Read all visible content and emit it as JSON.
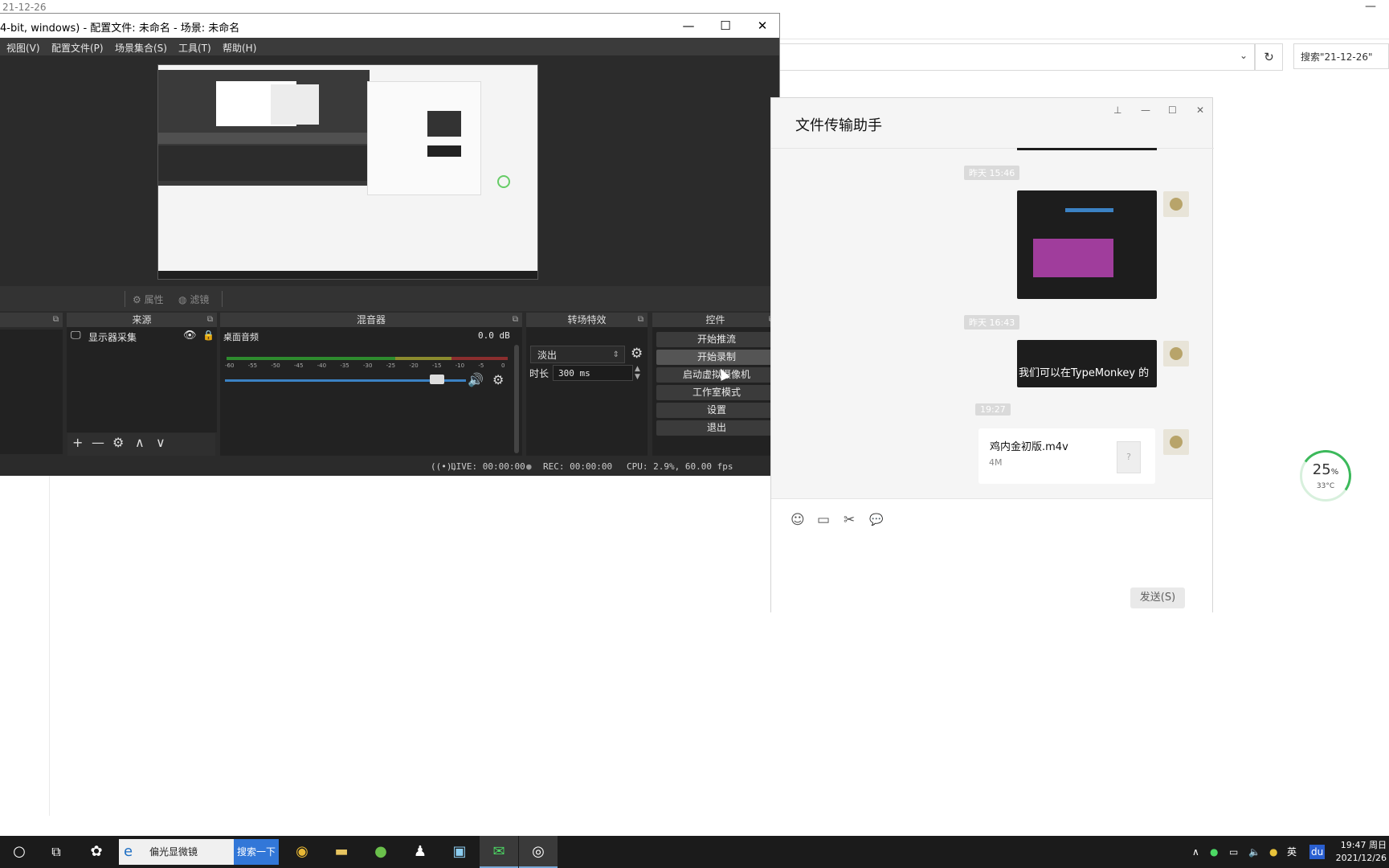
{
  "explorer": {
    "title_fragment": "21-12-26",
    "minimize": "—",
    "refresh_icon": "↻",
    "search_placeholder": "搜索\"21-12-26\""
  },
  "obs": {
    "title": "4-bit, windows) - 配置文件: 未命名 - 场景: 未命名",
    "window_buttons": {
      "minimize": "—",
      "maximize": "☐",
      "close": "✕"
    },
    "menu": [
      "视图(V)",
      "配置文件(P)",
      "场景集合(S)",
      "工具(T)",
      "帮助(H)"
    ],
    "toolbar": {
      "properties": "属性",
      "filters": "滤镜"
    },
    "docks": {
      "sources": "来源",
      "mixer": "混音器",
      "transitions": "转场特效",
      "controls": "控件"
    },
    "sources": {
      "items": [
        {
          "label": "显示器采集"
        }
      ]
    },
    "source_buttons": {
      "add": "+",
      "remove": "—",
      "settings": "⚙",
      "up": "∧",
      "down": "∨"
    },
    "mixer": {
      "track": "桌面音频",
      "db": "0.0 dB",
      "ticks": [
        "-60",
        "-55",
        "-50",
        "-45",
        "-40",
        "-35",
        "-30",
        "-25",
        "-20",
        "-15",
        "-10",
        "-5",
        "0"
      ],
      "volume": 0.88
    },
    "transitions": {
      "selected": "淡出",
      "duration_label": "时长",
      "duration": "300 ms"
    },
    "controls": [
      "开始推流",
      "开始录制",
      "启动虚拟摄像机",
      "工作室模式",
      "设置",
      "退出"
    ],
    "status": {
      "live": "LIVE: 00:00:00",
      "rec": "REC: 00:00:00",
      "cpu": "CPU: 2.9%, 60.00 fps"
    }
  },
  "wechat": {
    "title": "文件传输助手",
    "window_buttons": {
      "pin": "⊥",
      "minimize": "—",
      "maximize": "☐",
      "close": "✕"
    },
    "messages": {
      "time1": "昨天 15:46",
      "time2": "昨天 16:43",
      "video_caption": "我们可以在TypeMonkey 的",
      "time3": "19:27",
      "file_name": "鸡内金初版.m4v",
      "file_size": "4M",
      "file_icon": "?"
    },
    "tools": [
      "☺",
      "▭",
      "✂",
      "💬"
    ],
    "send_label": "发送(S)"
  },
  "widget": {
    "percent": "25",
    "unit": "%",
    "temp": "33°C"
  },
  "taskbar": {
    "ie_text": "偏光显微镜",
    "search_btn": "搜索一下",
    "tray": {
      "ime": "英",
      "baidu": "du"
    },
    "time": "19:47 周日",
    "date": "2021/12/26"
  }
}
